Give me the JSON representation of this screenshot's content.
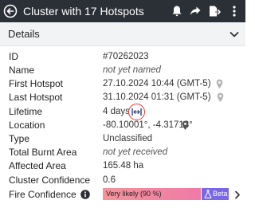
{
  "header": {
    "title": "Cluster with 17 Hotspots",
    "background": "#2b2f36"
  },
  "section": {
    "label": "Details"
  },
  "details": {
    "id_label": "ID",
    "id_value": "#70262023",
    "name_label": "Name",
    "name_value": "not yet named",
    "first_hotspot_label": "First Hotspot",
    "first_hotspot_value": "27.10.2024 10:44 (GMT-5)",
    "last_hotspot_label": "Last Hotspot",
    "last_hotspot_value": "31.10.2024 01:31 (GMT-5)",
    "lifetime_label": "Lifetime",
    "lifetime_value": "4 days",
    "location_label": "Location",
    "location_value": "-80.10001°, -4.31713°",
    "type_label": "Type",
    "type_value": "Unclassified",
    "total_burnt_area_label": "Total Burnt Area",
    "total_burnt_area_value": "not yet received",
    "affected_area_label": "Affected Area",
    "affected_area_value": "165.48 ha",
    "cluster_confidence_label": "Cluster Confidence",
    "cluster_confidence_value": "0.6",
    "fire_confidence_label": "Fire Confidence",
    "fire_confidence_value": "Very likely (90 %)",
    "fire_confidence_percent": 90,
    "beta_label": "Beta"
  },
  "colors": {
    "highlight_ring": "#e53935",
    "confidence_bar": "#f08a9f",
    "beta_badge": "#7a67e8"
  },
  "icons": {
    "back": "back-arrow-icon",
    "notifications": "bell-icon",
    "share": "share-arrow-icon",
    "export": "export-document-icon",
    "more": "more-vertical-icon",
    "collapse": "chevron-down-icon",
    "first_hotspot": "map-pin-icon",
    "last_hotspot": "map-pin-icon",
    "lifetime": "expand-horizontal-icon",
    "location": "map-pin-icon",
    "info": "info-icon",
    "beta": "flask-icon",
    "fire_confidence_more": "chevron-right-icon"
  }
}
